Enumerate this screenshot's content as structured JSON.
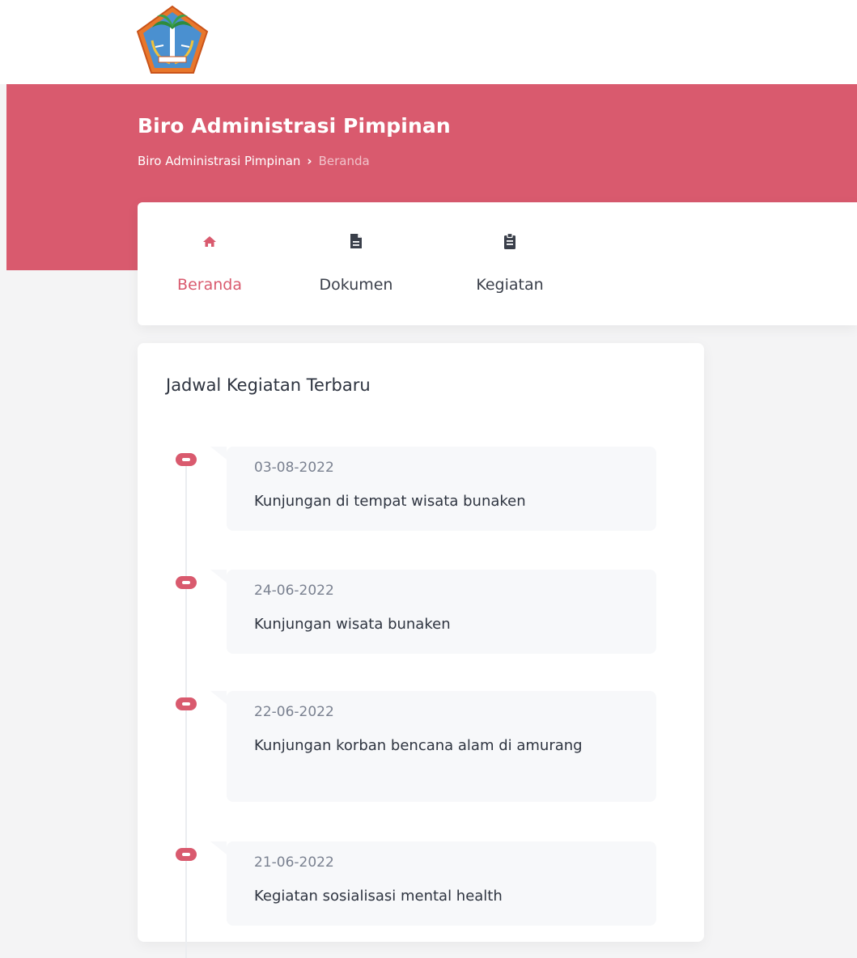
{
  "header": {
    "logo_icon": "provincial-emblem-icon"
  },
  "hero": {
    "title": "Biro Administrasi Pimpinan",
    "breadcrumb": {
      "root": "Biro Administrasi Pimpinan",
      "separator": "›",
      "current": "Beranda"
    }
  },
  "nav": {
    "items": [
      {
        "label": "Beranda",
        "icon": "home-icon",
        "active": true
      },
      {
        "label": "Dokumen",
        "icon": "document-icon",
        "active": false
      },
      {
        "label": "Kegiatan",
        "icon": "clipboard-icon",
        "active": false
      }
    ]
  },
  "schedule": {
    "title": "Jadwal Kegiatan Terbaru",
    "items": [
      {
        "date": "03-08-2022",
        "text": "Kunjungan di tempat wisata bunaken"
      },
      {
        "date": "24-06-2022",
        "text": "Kunjungan wisata bunaken"
      },
      {
        "date": "22-06-2022",
        "text": "Kunjungan korban bencana alam di amurang"
      },
      {
        "date": "21-06-2022",
        "text": "Kegiatan sosialisasi mental health"
      }
    ]
  },
  "colors": {
    "accent": "#d95a6e",
    "page_bg": "#f4f4f5",
    "timeline_box": "#f7f8fa"
  }
}
